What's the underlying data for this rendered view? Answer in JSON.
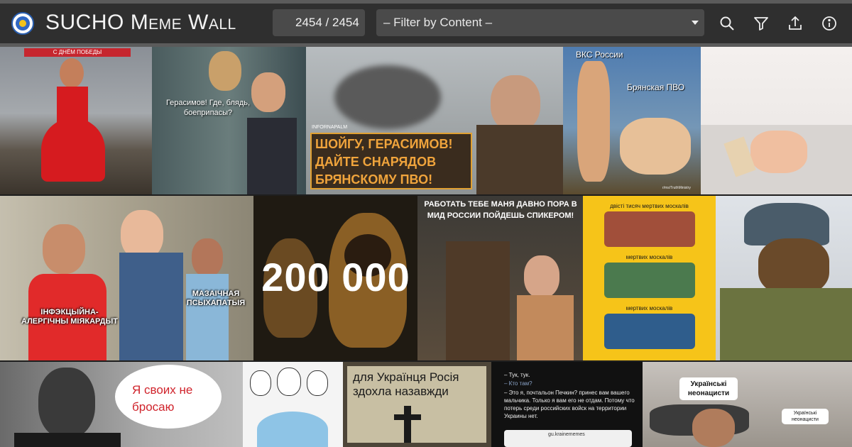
{
  "app": {
    "title_main": "SUCHO",
    "title_rest": "Meme Wall",
    "counter": "2454 / 2454",
    "filter_placeholder": "– Filter by Content –",
    "logo_icon": "sucho-logo-icon"
  },
  "toolbar": {
    "icons": [
      "search-icon",
      "filter-icon",
      "upload-icon",
      "info-icon"
    ]
  },
  "memes": {
    "m1_banner": "С ДНЁМ ПОБЕДЫ",
    "m2_text": "Герасимов! Где, блядь, боеприпасы?",
    "m3_tag": "INFORNAPALM",
    "m3_text": "ШОЙГУ, ГЕРАСИМОВ! ДАЙТЕ СНАРЯДОВ БРЯНСКОМУ ПВО!",
    "m4_top": "ВКС России",
    "m4_mid": "Брянская ПВО",
    "m4_credit": "r/ms/TruthMinistry",
    "m6_label_left": "ІНФЭКЦЫЙНА-АЛЕРГІЧНЫ МІЯКАРДЫТ",
    "m6_label_right": "МАЗАІЧНАЯ ПСЫХАПАТЫЯ",
    "m7_number": "200 000",
    "m8_text": "РАБОТАТЬ ТЕБЕ МАНЯ ДАВНО ПОРА В МИД РОССИИ ПОЙДЕШЬ СПИКЕРОМ!",
    "m9_line1": "двісті тисяч мертвих москалів",
    "m9_line2": "мертвих москалів",
    "m9_line3": "мертвих москалів",
    "m11_bubble": "Я своих не бросаю",
    "m13_text": "для Українця Росія здохла назавжди",
    "m14_l1": "– Тук, тук.",
    "m14_l2": "– Кто там?",
    "m14_l3": "– Это я, почтальон Печкин? принес вам вашего мальчика. Только я вам его не отдам. Потому что потерь среди российских войск на территории Украины нет.",
    "m14_source": "gu.krainememes",
    "m15_label1": "Українські неонацисти",
    "m15_label2": "Українські неонацисти"
  }
}
